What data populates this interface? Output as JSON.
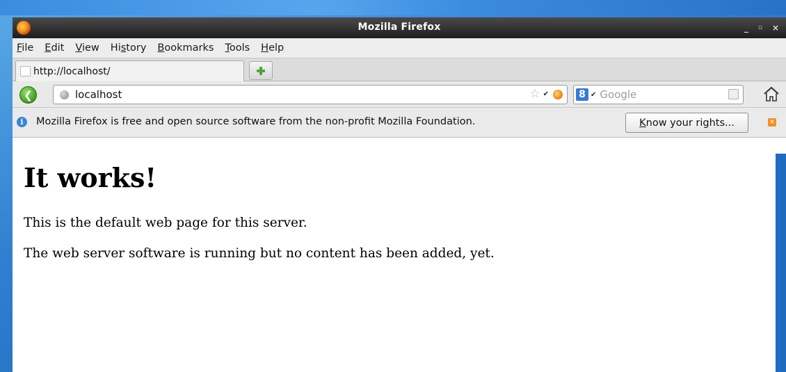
{
  "window": {
    "title": "Mozilla Firefox",
    "controls": {
      "minimize": "_",
      "maximize": "▫",
      "close": "×"
    }
  },
  "menubar": {
    "items": [
      {
        "label": "File",
        "accel": "F",
        "rest": "ile"
      },
      {
        "label": "Edit",
        "accel": "E",
        "rest": "dit"
      },
      {
        "label": "View",
        "accel": "V",
        "rest": "iew"
      },
      {
        "label": "History",
        "pre": "Hi",
        "accel": "s",
        "rest": "tory"
      },
      {
        "label": "Bookmarks",
        "accel": "B",
        "rest": "ookmarks"
      },
      {
        "label": "Tools",
        "accel": "T",
        "rest": "ools"
      },
      {
        "label": "Help",
        "accel": "H",
        "rest": "elp"
      }
    ]
  },
  "tabs": [
    {
      "label": "http://localhost/"
    }
  ],
  "navbar": {
    "url": "localhost",
    "search_placeholder": "Google",
    "search_engine_letter": "8"
  },
  "notification": {
    "text": "Mozilla Firefox is free and open source software from the non-profit Mozilla Foundation.",
    "button_accel": "K",
    "button_rest": "now your rights..."
  },
  "page": {
    "heading": "It works!",
    "paragraphs": [
      "This is the default web page for this server.",
      "The web server software is running but no content has been added, yet."
    ]
  },
  "colors": {
    "titlebar": "#1e1e1e",
    "desktop": "#2f7fd0",
    "back_button": "#4fae2a",
    "info_icon": "#3d83d6",
    "close_badge": "#f0902a"
  }
}
